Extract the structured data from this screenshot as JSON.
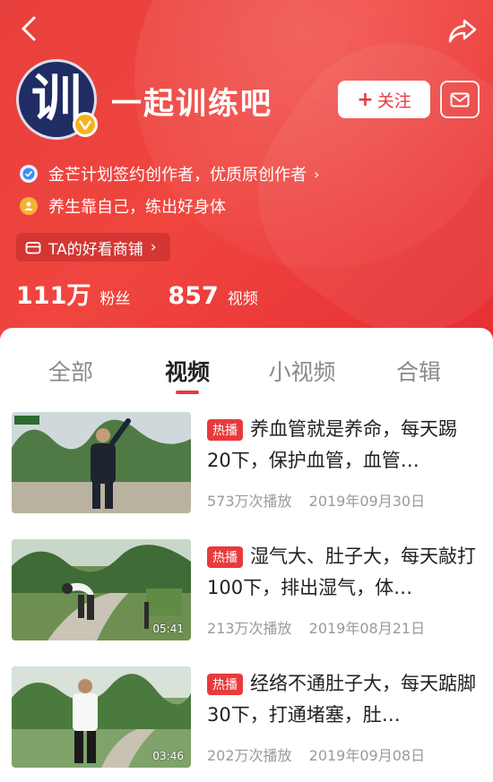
{
  "profile": {
    "avatar_glyph": "训",
    "name": "一起训练吧",
    "follow_label": "关注",
    "follow_plus": "+",
    "cert_text": "金芒计划签约创作者，优质原创作者",
    "motto": "养生靠自己，练出好身体",
    "shop_label": "TA的好看商铺",
    "fans_count": "111万",
    "fans_label": "粉丝",
    "videos_count": "857",
    "videos_label": "视频"
  },
  "tabs": [
    {
      "label": "全部"
    },
    {
      "label": "视频"
    },
    {
      "label": "小视频"
    },
    {
      "label": "合辑"
    }
  ],
  "active_tab": "视频",
  "videos": [
    {
      "badge": "热播",
      "title": "养血管就是养命，每天踢20下，保护血管，血管…",
      "plays": "573万次播放",
      "date": "2019年09月30日",
      "duration": ""
    },
    {
      "badge": "热播",
      "title": "湿气大、肚子大，每天敲打100下，排出湿气，体…",
      "plays": "213万次播放",
      "date": "2019年08月21日",
      "duration": "05:41"
    },
    {
      "badge": "热播",
      "title": "经络不通肚子大，每天踮脚30下，打通堵塞，肚…",
      "plays": "202万次播放",
      "date": "2019年09月08日",
      "duration": "03:46"
    }
  ],
  "colors": {
    "accent": "#e83a3c",
    "header_bg": "#ef433f",
    "avatar_bg": "#1f2d64",
    "badge_gold": "#f6b21c"
  },
  "icons": [
    "back-arrow-icon",
    "share-icon",
    "verified-icon",
    "person-icon",
    "shop-icon",
    "mail-icon"
  ]
}
